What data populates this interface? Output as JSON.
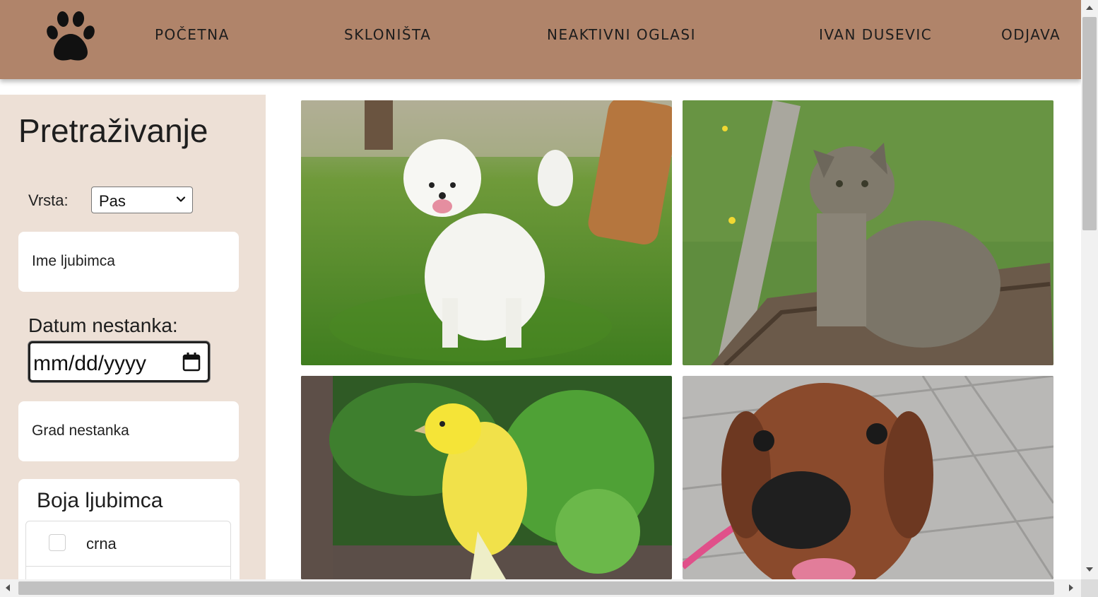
{
  "nav": {
    "logo_icon": "paw-icon",
    "items": [
      {
        "label": "POČETNA"
      },
      {
        "label": "SKLONIŠTA"
      },
      {
        "label": "NEAKTIVNI OGLASI"
      },
      {
        "label": "IVAN DUSEVIC"
      },
      {
        "label": "ODJAVA"
      }
    ]
  },
  "sidebar": {
    "title": "Pretraživanje",
    "vrsta_label": "Vrsta:",
    "vrsta_value": "Pas",
    "ime_placeholder": "Ime ljubimca",
    "datum_label": "Datum nestanka:",
    "datum_value": "mm/dd/yyyy",
    "grad_placeholder": "Grad nestanka",
    "boja_title": "Boja ljubimca",
    "colors": [
      {
        "label": "crna",
        "checked": false
      },
      {
        "label": "",
        "checked": false
      }
    ]
  },
  "gallery": {
    "items": [
      {
        "animal": "white-dog-photo"
      },
      {
        "animal": "tabby-cat-photo"
      },
      {
        "animal": "yellow-canary-photo"
      },
      {
        "animal": "brown-puppy-photo"
      }
    ]
  },
  "colors": {
    "header_bg": "#b0846a",
    "sidebar_bg": "#ede0d6"
  }
}
